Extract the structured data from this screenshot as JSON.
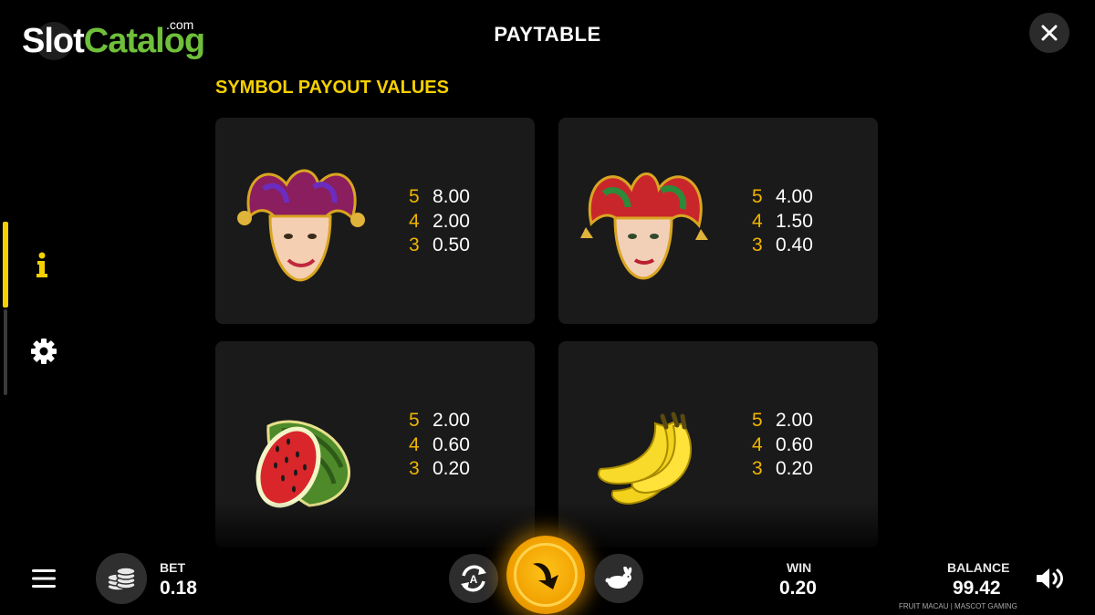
{
  "logo": {
    "part1": "Slot",
    "part2": "Catalog",
    "suffix": ".com"
  },
  "header": {
    "title": "PAYTABLE"
  },
  "section": {
    "title": "SYMBOL PAYOUT VALUES"
  },
  "symbols": [
    {
      "icon": "jester-purple-icon",
      "pays": [
        {
          "count": "5",
          "value": "8.00"
        },
        {
          "count": "4",
          "value": "2.00"
        },
        {
          "count": "3",
          "value": "0.50"
        }
      ]
    },
    {
      "icon": "jester-red-green-icon",
      "pays": [
        {
          "count": "5",
          "value": "4.00"
        },
        {
          "count": "4",
          "value": "1.50"
        },
        {
          "count": "3",
          "value": "0.40"
        }
      ]
    },
    {
      "icon": "watermelon-icon",
      "pays": [
        {
          "count": "5",
          "value": "2.00"
        },
        {
          "count": "4",
          "value": "0.60"
        },
        {
          "count": "3",
          "value": "0.20"
        }
      ]
    },
    {
      "icon": "banana-icon",
      "pays": [
        {
          "count": "5",
          "value": "2.00"
        },
        {
          "count": "4",
          "value": "0.60"
        },
        {
          "count": "3",
          "value": "0.20"
        }
      ]
    }
  ],
  "footer": {
    "bet_label": "BET",
    "bet_value": "0.18",
    "win_label": "WIN",
    "win_value": "0.20",
    "balance_label": "BALANCE",
    "balance_value": "99.42",
    "credit": "FRUIT MACAU | MASCOT GAMING"
  },
  "colors": {
    "accent": "#f5d000",
    "payout_count": "#f0b400",
    "card_bg": "#1a1a1a",
    "spin": "#f0a000"
  }
}
